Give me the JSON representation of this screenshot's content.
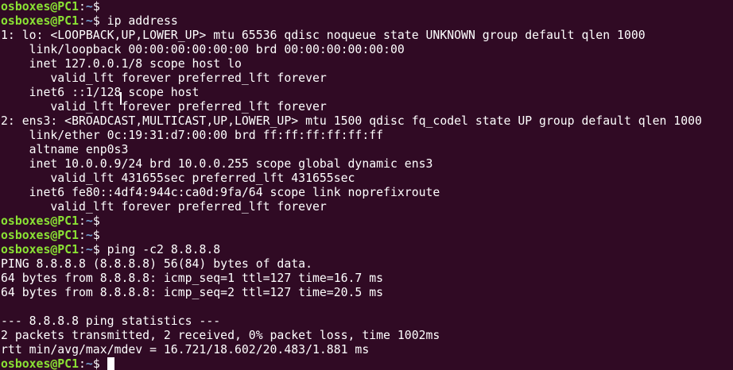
{
  "theme": {
    "background": "#300a24",
    "foreground": "#ffffff",
    "user_color": "#8ae234",
    "path_color": "#729fcf"
  },
  "lines": [
    {
      "type": "prompt",
      "user": "osboxes@PC1",
      "path": "~",
      "cmd": ""
    },
    {
      "type": "prompt",
      "user": "osboxes@PC1",
      "path": "~",
      "cmd": " ip address"
    },
    {
      "type": "output",
      "text": "1: lo: <LOOPBACK,UP,LOWER_UP> mtu 65536 qdisc noqueue state UNKNOWN group default qlen 1000"
    },
    {
      "type": "output",
      "text": "    link/loopback 00:00:00:00:00:00 brd 00:00:00:00:00:00"
    },
    {
      "type": "output",
      "text": "    inet 127.0.0.1/8 scope host lo"
    },
    {
      "type": "output",
      "text": "       valid_lft forever preferred_lft forever"
    },
    {
      "type": "output",
      "text": "    inet6 ::1/128 scope host"
    },
    {
      "type": "output",
      "text": "       valid_lft forever preferred_lft forever"
    },
    {
      "type": "output",
      "text": "2: ens3: <BROADCAST,MULTICAST,UP,LOWER_UP> mtu 1500 qdisc fq_codel state UP group default qlen 1000"
    },
    {
      "type": "output",
      "text": "    link/ether 0c:19:31:d7:00:00 brd ff:ff:ff:ff:ff:ff"
    },
    {
      "type": "output",
      "text": "    altname enp0s3"
    },
    {
      "type": "output",
      "text": "    inet 10.0.0.9/24 brd 10.0.0.255 scope global dynamic ens3"
    },
    {
      "type": "output",
      "text": "       valid_lft 431655sec preferred_lft 431655sec"
    },
    {
      "type": "output",
      "text": "    inet6 fe80::4df4:944c:ca0d:9fa/64 scope link noprefixroute"
    },
    {
      "type": "output",
      "text": "       valid_lft forever preferred_lft forever"
    },
    {
      "type": "prompt",
      "user": "osboxes@PC1",
      "path": "~",
      "cmd": ""
    },
    {
      "type": "prompt",
      "user": "osboxes@PC1",
      "path": "~",
      "cmd": ""
    },
    {
      "type": "prompt",
      "user": "osboxes@PC1",
      "path": "~",
      "cmd": " ping -c2 8.8.8.8"
    },
    {
      "type": "output",
      "text": "PING 8.8.8.8 (8.8.8.8) 56(84) bytes of data."
    },
    {
      "type": "output",
      "text": "64 bytes from 8.8.8.8: icmp_seq=1 ttl=127 time=16.7 ms"
    },
    {
      "type": "output",
      "text": "64 bytes from 8.8.8.8: icmp_seq=2 ttl=127 time=20.5 ms"
    },
    {
      "type": "output",
      "text": ""
    },
    {
      "type": "output",
      "text": "--- 8.8.8.8 ping statistics ---"
    },
    {
      "type": "output",
      "text": "2 packets transmitted, 2 received, 0% packet loss, time 1002ms"
    },
    {
      "type": "output",
      "text": "rtt min/avg/max/mdev = 16.721/18.602/20.483/1.881 ms"
    },
    {
      "type": "prompt",
      "user": "osboxes@PC1",
      "path": "~",
      "cmd": "",
      "cursor": true
    }
  ]
}
